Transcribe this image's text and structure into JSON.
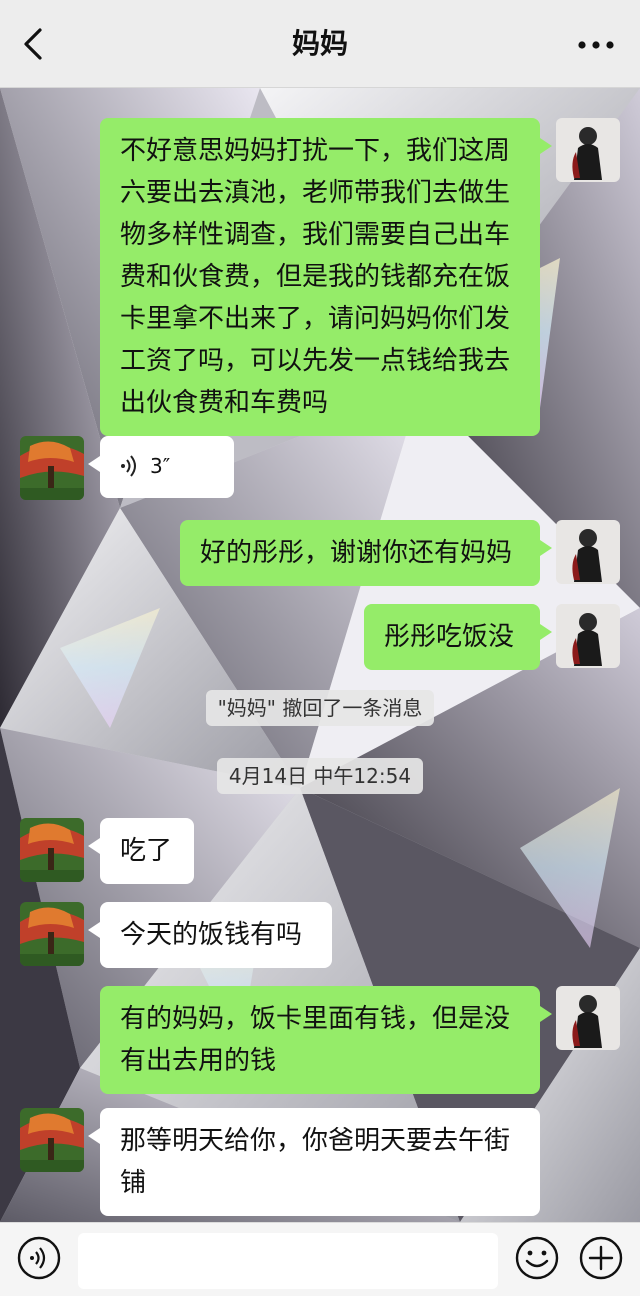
{
  "header": {
    "title": "妈妈",
    "back_icon": "chevron-left-icon",
    "more_icon": "more-dots-icon"
  },
  "messages": [
    {
      "from": "me",
      "text": "不好意思妈妈打扰一下，我们这周六要出去滇池，老师带我们去做生物多样性调查，我们需要自己出车费和伙食费，但是我的钱都充在饭卡里拿不出来了，请问妈妈你们发工资了吗，可以先发一点钱给我去出伙食费和车费吗"
    },
    {
      "from": "them",
      "type": "voice",
      "duration": "3″"
    },
    {
      "from": "me",
      "text": "好的彤彤，谢谢你还有妈妈"
    },
    {
      "from": "me",
      "text": "彤彤吃饭没"
    },
    {
      "type": "system",
      "text": "\"妈妈\" 撤回了一条消息"
    },
    {
      "type": "time",
      "text": "4月14日 中午12:54"
    },
    {
      "from": "them",
      "text": "吃了"
    },
    {
      "from": "them",
      "text": "今天的饭钱有吗"
    },
    {
      "from": "me",
      "text": "有的妈妈，饭卡里面有钱，但是没有出去用的钱"
    },
    {
      "from": "them",
      "text": "那等明天给你，你爸明天要去午街铺"
    }
  ],
  "footer": {
    "voice_icon": "voice-input-icon",
    "emoji_icon": "emoji-icon",
    "plus_icon": "plus-icon",
    "input_value": ""
  },
  "colors": {
    "me_bubble": "#95ec69",
    "them_bubble": "#ffffff",
    "header_bg": "#ededed"
  }
}
